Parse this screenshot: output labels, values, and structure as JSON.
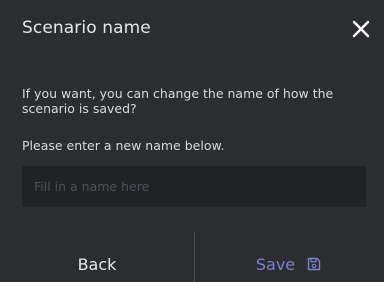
{
  "dialog": {
    "title": "Scenario name",
    "description": "If you want, you can change the name of how the scenario is saved?",
    "instruction": "Please enter a new name below.",
    "input": {
      "value": "",
      "placeholder": "Fill in a name here"
    },
    "back_label": "Back",
    "save_label": "Save"
  },
  "icons": {
    "close": "close-icon",
    "save": "floppy-disk-icon"
  },
  "colors": {
    "background": "#2b2d31",
    "input_background": "#212226",
    "text": "#e6e7ea",
    "accent": "#7b82d2",
    "placeholder": "#4d4f56",
    "divider": "#4a4c52"
  }
}
